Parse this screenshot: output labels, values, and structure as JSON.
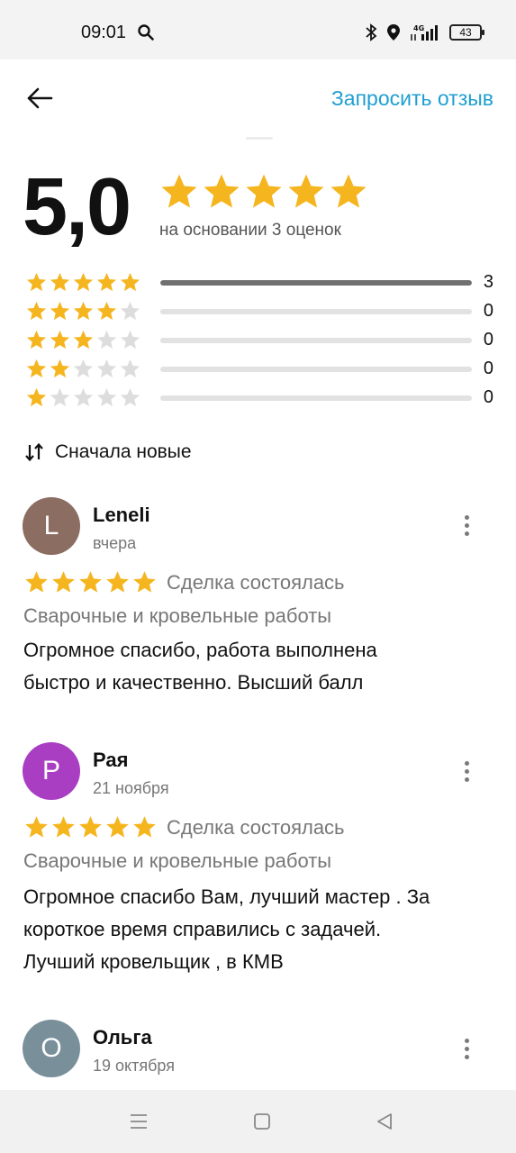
{
  "status_bar": {
    "time": "09:01",
    "network": "4G",
    "battery": "43"
  },
  "header": {
    "request_review_label": "Запросить отзыв"
  },
  "summary": {
    "rating": "5,0",
    "stars": 5,
    "caption": "на основании 3 оценок"
  },
  "breakdown": [
    {
      "stars": 5,
      "count": "3",
      "fraction": 1.0
    },
    {
      "stars": 4,
      "count": "0",
      "fraction": 0
    },
    {
      "stars": 3,
      "count": "0",
      "fraction": 0
    },
    {
      "stars": 2,
      "count": "0",
      "fraction": 0
    },
    {
      "stars": 1,
      "count": "0",
      "fraction": 0
    }
  ],
  "sort": {
    "label": "Сначала новые"
  },
  "reviews": [
    {
      "initial": "L",
      "author": "Leneli",
      "date": "вчера",
      "stars": 5,
      "deal_status": "Сделка состоялась",
      "category": "Сварочные и кровельные работы",
      "text_lines": [
        "Огромное спасибо, работа выполнена",
        "быстро и качественно. Высший балл"
      ],
      "avatar_color": "#8b6d62"
    },
    {
      "initial": "Р",
      "author": "Рая",
      "date": "21 ноября",
      "stars": 5,
      "deal_status": "Сделка состоялась",
      "category": "Сварочные и кровельные работы",
      "text_lines": [
        "Огромное спасибо Вам, лучший мастер . За",
        "короткое время справились с задачей.",
        "Лучший кровельщик , в КМВ"
      ],
      "avatar_color": "#a93ec2"
    },
    {
      "initial": "О",
      "author": "Ольга",
      "date": "19 октября",
      "avatar_color": "#79909b"
    }
  ],
  "colors": {
    "accent": "#1e9fd0",
    "star_filled": "#f5b51f",
    "star_empty": "#dddddd"
  }
}
